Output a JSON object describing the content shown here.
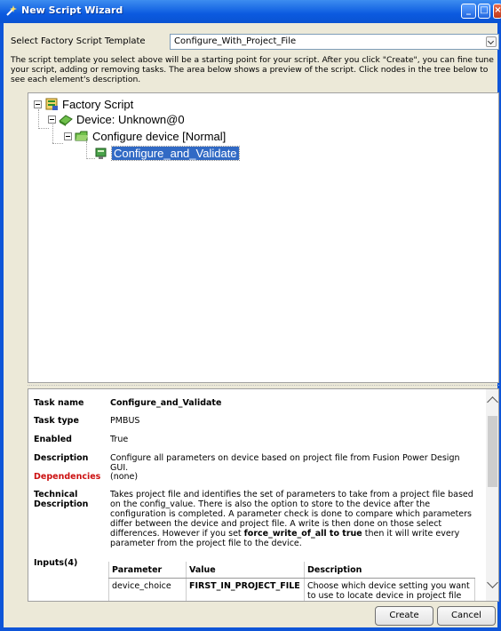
{
  "window": {
    "title": "New Script Wizard"
  },
  "template": {
    "label": "Select Factory Script Template",
    "selected": "Configure_With_Project_File"
  },
  "intro_text": "The script template you select above will be a starting point for your script.  After you click \"Create\", you can fine tune your script, adding or removing tasks.  The area below shows a preview of the script.  Click nodes in the tree below to see each element's description.",
  "tree": {
    "root": "Factory Script",
    "device": "Device: Unknown@0",
    "configure": "Configure device [Normal]",
    "task": "Configure_and_Validate"
  },
  "details": {
    "task_name_label": "Task name",
    "task_name": "Configure_and_Validate",
    "task_type_label": "Task type",
    "task_type": "PMBUS",
    "enabled_label": "Enabled",
    "enabled": "True",
    "description_label": "Description",
    "description": "Configure all parameters on device based on project file from Fusion Power Design GUI.",
    "dependencies_label": "Dependencies",
    "dependencies": "(none)",
    "technical_label": "Technical Description",
    "technical_pre": "Takes project file and identifies the set of parameters to take from a project file based on the config_value. There is also the option to store to the device after the configuration is completed. A parameter check is done to compare which parameters differ between the device and project file. A write is then done on those select differences. However if you set ",
    "technical_bold": "force_write_of_all to true",
    "technical_post": " then it will write every parameter from the project file to the device.",
    "inputs_label": "Inputs(4)",
    "inputs_headers": [
      "Parameter",
      "Value",
      "Description"
    ],
    "inputs_rows": [
      [
        "device_choice",
        "FIRST_IN_PROJECT_FILE",
        "Choose which device setting you want to use to locate device in project file"
      ]
    ]
  },
  "buttons": {
    "create": "Create",
    "cancel": "Cancel"
  },
  "colors": {
    "titlebar": "#0b5ae0",
    "selection": "#316ac5",
    "dependencies": "#cc1111"
  }
}
